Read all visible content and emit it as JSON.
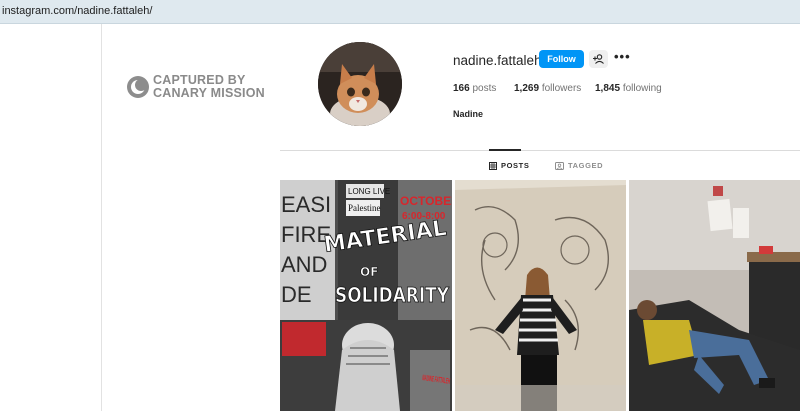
{
  "browser": {
    "url": "instagram.com/nadine.fattaleh/"
  },
  "watermark": {
    "line1": "CAPTURED BY",
    "line2": "CANARY MISSION"
  },
  "profile": {
    "username": "nadine.fattaleh",
    "follow_label": "Follow",
    "more_label": "•••",
    "full_name": "Nadine",
    "stats": {
      "posts_count": "166",
      "posts_label": "posts",
      "followers_count": "1,269",
      "followers_label": "followers",
      "following_count": "1,845",
      "following_label": "following"
    }
  },
  "tabs": {
    "posts": "POSTS",
    "tagged": "TAGGED"
  },
  "posts": {
    "p1": {
      "sign_long_live": "LONG LIVE",
      "sign_palestine": "Palestine",
      "date_line1": "OCTOBER",
      "date_line2": "6:00-8:00",
      "title_line1": "MATERIAL",
      "title_line2": "OF",
      "title_line3": "SOLIDARITY",
      "bg_letters_1": "EASI",
      "bg_letters_2": "FIRE",
      "bg_letters_3": "AND",
      "bg_letters_4": "DE",
      "artist_credit": "NADINE FATTALEH"
    }
  },
  "colors": {
    "accent": "#0095f6",
    "poster_red": "#d8262c"
  }
}
